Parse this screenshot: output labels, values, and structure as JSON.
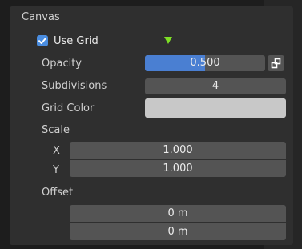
{
  "section": {
    "title": "Canvas"
  },
  "use_grid": {
    "label": "Use Grid",
    "checked": true
  },
  "opacity": {
    "label": "Opacity",
    "value": "0.500",
    "fraction": 0.5
  },
  "subdivisions": {
    "label": "Subdivisions",
    "value": "4"
  },
  "grid_color": {
    "label": "Grid Color",
    "color": "#c8c8c8"
  },
  "scale": {
    "label": "Scale",
    "x_label": "X",
    "x_value": "1.000",
    "y_label": "Y",
    "y_value": "1.000"
  },
  "offset": {
    "label": "Offset",
    "values": [
      "0 m",
      "0 m"
    ]
  },
  "colors": {
    "accent": "#4a7fd2",
    "checkbox": "#4a8de0",
    "keyframe_marker": "#7ee025"
  }
}
